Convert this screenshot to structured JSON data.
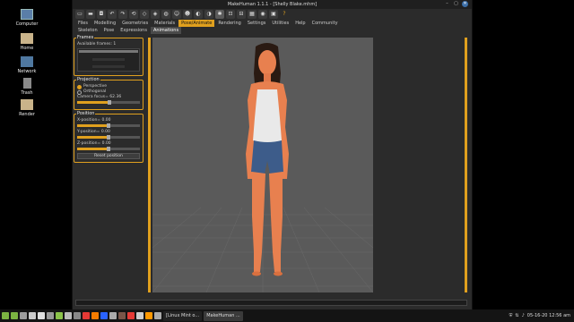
{
  "desktop": {
    "icons": [
      {
        "label": "Computer",
        "icon": "computer-icon"
      },
      {
        "label": "Home",
        "icon": "folder-icon"
      },
      {
        "label": "Network",
        "icon": "network-icon"
      },
      {
        "label": "Trash",
        "icon": "trash-icon"
      },
      {
        "label": "Render",
        "icon": "folder-icon"
      }
    ]
  },
  "window": {
    "title": "MakeHuman 1.1.1 - [Shelly Blake.mhm]",
    "controls": {
      "minimize": "–",
      "maximize": "▢",
      "close": "✕"
    }
  },
  "main_tabs": [
    "Files",
    "Modelling",
    "Geometries",
    "Materials",
    "Pose/Animate",
    "Rendering",
    "Settings",
    "Utilities",
    "Help",
    "Community"
  ],
  "main_tab_active": "Pose/Animate",
  "sub_tabs": [
    "Skeleton",
    "Pose",
    "Expressions",
    "Animations"
  ],
  "sub_tab_active": "Animations",
  "panel": {
    "frames": {
      "title": "Frames",
      "available_frames": "Available frames: 1"
    },
    "projection": {
      "title": "Projection",
      "perspective": "Perspective",
      "orthogonal": "Orthogonal",
      "selected": "Perspective",
      "camera_focus": "Camera focus= 62.36",
      "camera_focus_value": 0.52
    },
    "position": {
      "title": "Position",
      "x_position": "X-position= 0.00",
      "y_position": "Y-position= 0.00",
      "z_position": "Z-position= 0.00",
      "x_value": 0.5,
      "y_value": 0.5,
      "z_value": 0.5,
      "reset_button": "Reset position"
    }
  },
  "colors": {
    "accent": "#e0a01e",
    "viewport_bg": "#5a5a5a",
    "skin": "#e8804f",
    "top": "#e9e9e9",
    "shorts": "#3d5c8a",
    "hair": "#2a1a12"
  },
  "taskbar": {
    "items": [
      {
        "label": "[Linux Mint o...",
        "active": false
      },
      {
        "label": "MakeHuman ...",
        "active": true
      }
    ],
    "clock": "05-16-20 12:56 am"
  }
}
